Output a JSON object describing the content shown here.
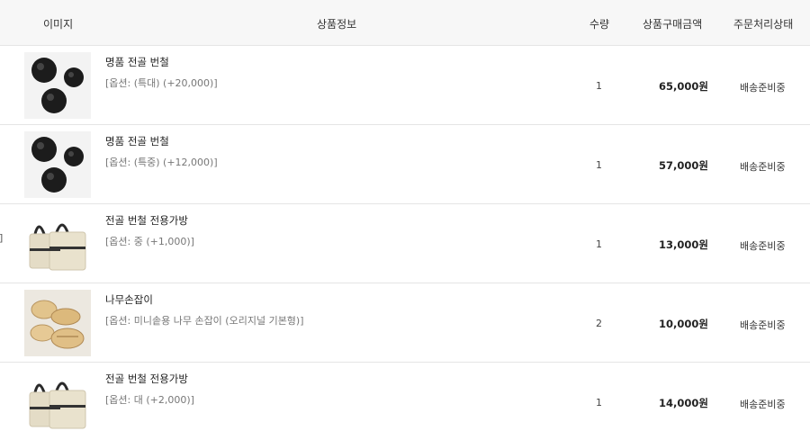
{
  "table": {
    "headers": {
      "image": "이미지",
      "info": "상품정보",
      "quantity": "수량",
      "price": "상품구매금액",
      "status": "주문처리상태"
    },
    "side_mark": "]",
    "rows": [
      {
        "name": "명품 전골 번철",
        "option": "[옵션: (특대) (+20,000)]",
        "quantity": "1",
        "price": "65,000원",
        "status": "배송준비중",
        "image_icon": "cast-iron-pan-icon"
      },
      {
        "name": "명품 전골 번철",
        "option": "[옵션: (특중) (+12,000)]",
        "quantity": "1",
        "price": "57,000원",
        "status": "배송준비중",
        "image_icon": "cast-iron-pan-icon"
      },
      {
        "name": "전골 번철 전용가방",
        "option": "[옵션: 중 (+1,000)]",
        "quantity": "1",
        "price": "13,000원",
        "status": "배송준비중",
        "image_icon": "canvas-bag-icon"
      },
      {
        "name": "나무손잡이",
        "option": "[옵션: 미니솥용 나무 손잡이 (오리지널 기본형)]",
        "quantity": "2",
        "price": "10,000원",
        "status": "배송준비중",
        "image_icon": "wooden-handle-icon"
      },
      {
        "name": "전골 번철 전용가방",
        "option": "[옵션: 대 (+2,000)]",
        "quantity": "1",
        "price": "14,000원",
        "status": "배송준비중",
        "image_icon": "canvas-bag-icon"
      }
    ]
  }
}
